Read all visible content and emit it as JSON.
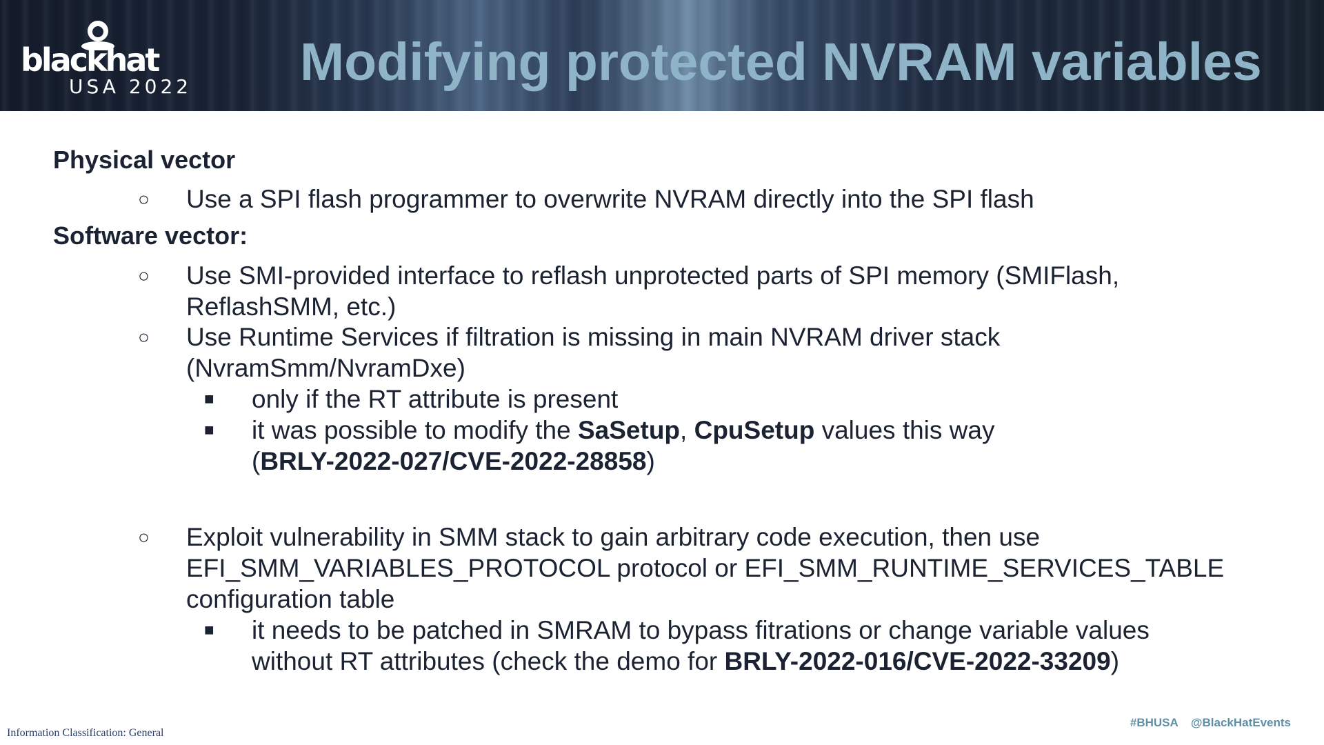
{
  "header": {
    "logo_main": "blackhat",
    "logo_sub": "USA 2022",
    "title": "Modifying protected NVRAM variables"
  },
  "sections": {
    "physical": {
      "heading": "Physical vector",
      "bullet1": "Use a SPI flash programmer to overwrite NVRAM directly into the SPI flash"
    },
    "software": {
      "heading": "Software vector:",
      "bullet1_line1": "Use SMI-provided interface to reflash unprotected parts of SPI memory (SMIFlash,",
      "bullet1_line2": "ReflashSMM, etc.)",
      "bullet2_line1": "Use Runtime Services if filtration is missing in main NVRAM driver stack",
      "bullet2_line2": "(NvramSmm/NvramDxe)",
      "bullet2_sub1": "only if the RT attribute is present",
      "bullet2_sub2_pre": "it was possible to modify the ",
      "bullet2_sub2_b1": "SaSetup",
      "bullet2_sub2_mid": ", ",
      "bullet2_sub2_b2": "CpuSetup",
      "bullet2_sub2_post": " values this way",
      "bullet2_sub2_l2_open": "(",
      "bullet2_sub2_l2_bold": "BRLY-2022-027/CVE-2022-28858",
      "bullet2_sub2_l2_close": ")",
      "bullet3_line1": "Exploit vulnerability in SMM stack to gain arbitrary code execution, then use",
      "bullet3_line2": "EFI_SMM_VARIABLES_PROTOCOL protocol or EFI_SMM_RUNTIME_SERVICES_TABLE",
      "bullet3_line3": "configuration table",
      "bullet3_sub1_line1": "it needs to be patched in SMRAM to bypass fitrations or change variable values",
      "bullet3_sub1_line2_pre": "without RT attributes (check the demo for ",
      "bullet3_sub1_line2_bold": "BRLY-2022-016/CVE-2022-33209",
      "bullet3_sub1_line2_close": ")"
    }
  },
  "markers": {
    "level1": "○",
    "level2": "■"
  },
  "footer": {
    "classification": "Information Classification: General",
    "hashtag": "#BHUSA",
    "handle": "@BlackHatEvents"
  },
  "colors": {
    "title": "#8fb3c7",
    "body_text": "#1b2333",
    "footer_tags": "#5e8fa6"
  }
}
